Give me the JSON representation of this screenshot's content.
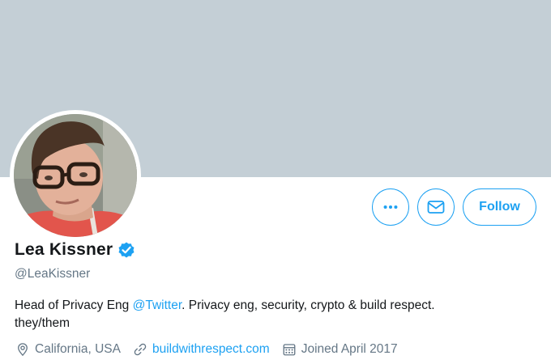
{
  "profile": {
    "name": "Lea Kissner",
    "handle": "@LeaKissner",
    "bio": {
      "prefix": "Head of Privacy Eng ",
      "mention": "@Twitter",
      "suffix": ". Privacy eng, security, crypto & build respect.",
      "line2": "they/them"
    },
    "location": "California, USA",
    "website": "buildwithrespect.com",
    "joined": "Joined April 2017",
    "verified_icon": "verified-badge-icon"
  },
  "actions": {
    "more_icon": "more-icon",
    "message_icon": "envelope-icon",
    "follow_label": "Follow"
  },
  "colors": {
    "banner": "#c4cfd6",
    "accent": "#1da1f2",
    "secondary_text": "#657786",
    "primary_text": "#14171a"
  }
}
